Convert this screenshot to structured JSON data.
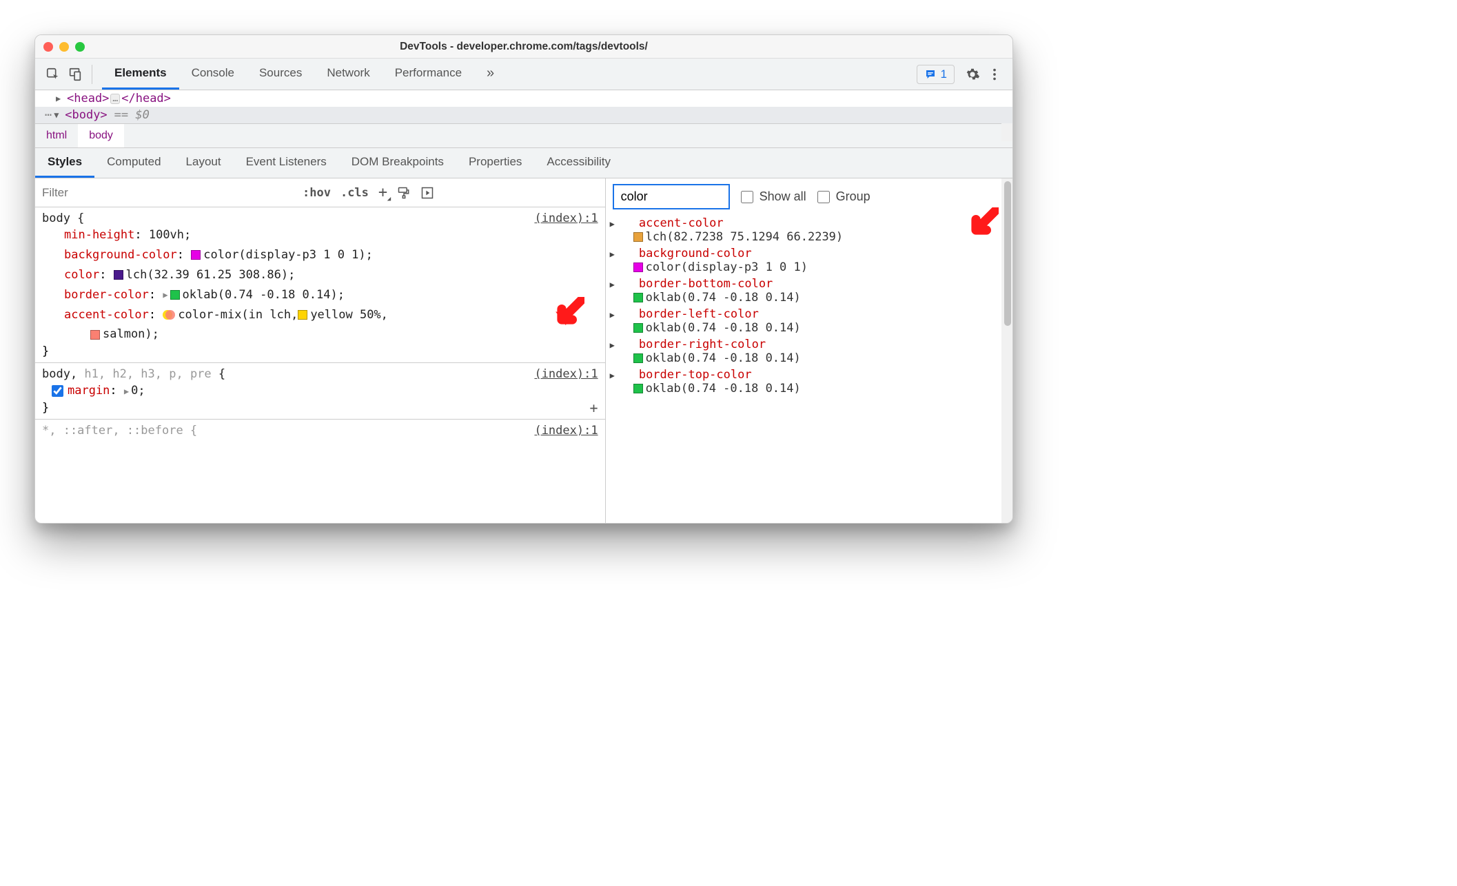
{
  "window": {
    "title": "DevTools - developer.chrome.com/tags/devtools/"
  },
  "toolbar": {
    "tabs": [
      "Elements",
      "Console",
      "Sources",
      "Network",
      "Performance"
    ],
    "overflow": "»",
    "issues_count": "1"
  },
  "dom": {
    "head_open": "<head>",
    "head_close": "</head>",
    "body_open": "<body>",
    "sel_marker": "== $0",
    "dots": "…"
  },
  "breadcrumb": {
    "items": [
      "html",
      "body"
    ]
  },
  "subtabs": [
    "Styles",
    "Computed",
    "Layout",
    "Event Listeners",
    "DOM Breakpoints",
    "Properties",
    "Accessibility"
  ],
  "filter": {
    "placeholder": "Filter",
    "hov": ":hov",
    "cls": ".cls",
    "plus": "+"
  },
  "rules": {
    "r0": {
      "selector": "body {",
      "src": "(index):1",
      "props": {
        "0": {
          "name": "min-height",
          "val": "100vh;"
        },
        "1": {
          "name": "background-color",
          "val": "color(display-p3 1 0 1);",
          "swcol": "#e600e6"
        },
        "2": {
          "name": "color",
          "val": "lch(32.39 61.25 308.86);",
          "swcol": "#4a1a8c"
        },
        "3": {
          "name": "border-color",
          "val": "oklab(0.74 -0.18 0.14);",
          "swcol": "#1fc24a",
          "tri": "1"
        },
        "4": {
          "name": "accent-color",
          "val_a": "color-mix(in lch, ",
          "val_b": "yellow 50%,",
          "swb": "#ffd400",
          "val_c": "salmon);",
          "swc": "#fa8072",
          "mix": "1"
        }
      },
      "close": "}"
    },
    "r1": {
      "selector_main": "body,",
      "selector_dim": " h1, h2, h3, p, pre",
      "selector_end": " {",
      "src": "(index):1",
      "p0": {
        "name": "margin",
        "val": "0;",
        "tri": "1",
        "chk": "1"
      },
      "close": "}"
    },
    "r2": {
      "selector": "*, ::after, ::before {",
      "src": "(index):1"
    }
  },
  "computed": {
    "filter_value": "color",
    "show_all_label": "Show all",
    "group_label": "Group",
    "items": {
      "0": {
        "key": "accent-color",
        "val": "lch(82.7238 75.1294 66.2239)",
        "sw": "#e8a23c"
      },
      "1": {
        "key": "background-color",
        "val": "color(display-p3 1 0 1)",
        "sw": "#e600e6"
      },
      "2": {
        "key": "border-bottom-color",
        "val": "oklab(0.74 -0.18 0.14)",
        "sw": "#1fc24a"
      },
      "3": {
        "key": "border-left-color",
        "val": "oklab(0.74 -0.18 0.14)",
        "sw": "#1fc24a"
      },
      "4": {
        "key": "border-right-color",
        "val": "oklab(0.74 -0.18 0.14)",
        "sw": "#1fc24a"
      },
      "5": {
        "key": "border-top-color",
        "val": "oklab(0.74 -0.18 0.14)",
        "sw": "#1fc24a"
      }
    }
  }
}
